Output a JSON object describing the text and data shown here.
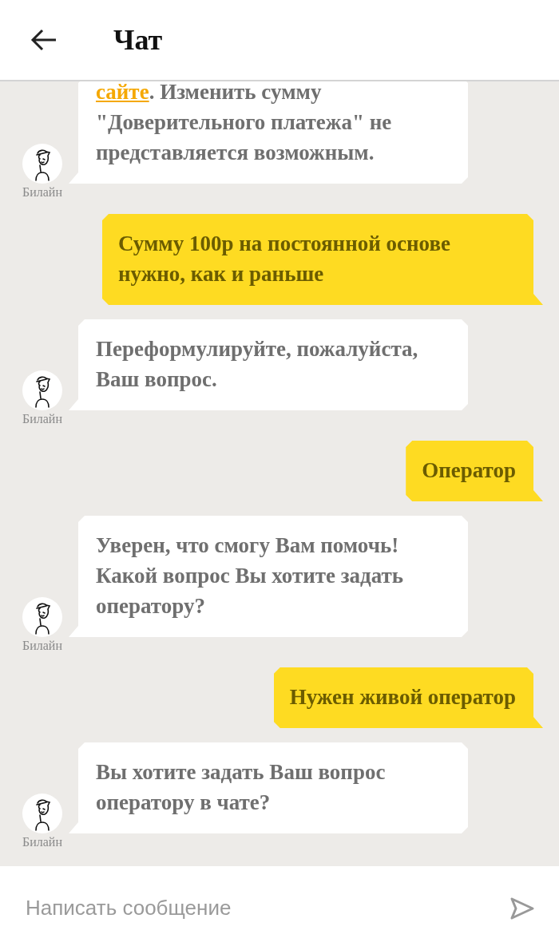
{
  "header": {
    "title": "Чат"
  },
  "messages": [
    {
      "kind": "bot",
      "author": "Билайн",
      "parts": [
        {
          "kind": "link",
          "text": "сайте"
        },
        {
          "kind": "text",
          "text": ". Изменить сумму \"Доверительного платежа\" не представляется возможным."
        }
      ]
    },
    {
      "kind": "user",
      "text": "Сумму 100р на постоянной основе нужно, как и раньше"
    },
    {
      "kind": "bot",
      "author": "Билайн",
      "text": "Переформулируйте, пожалуйста, Ваш вопрос."
    },
    {
      "kind": "user",
      "text": "Оператор"
    },
    {
      "kind": "bot",
      "author": "Билайн",
      "text": "Уверен, что смогу Вам помочь! Какой вопрос Вы хотите задать оператору?"
    },
    {
      "kind": "user",
      "text": "Нужен живой оператор"
    },
    {
      "kind": "bot",
      "author": "Билайн",
      "text": "Вы хотите задать Ваш вопрос оператору в чате?"
    }
  ],
  "composer": {
    "placeholder": "Написать сообщение"
  }
}
